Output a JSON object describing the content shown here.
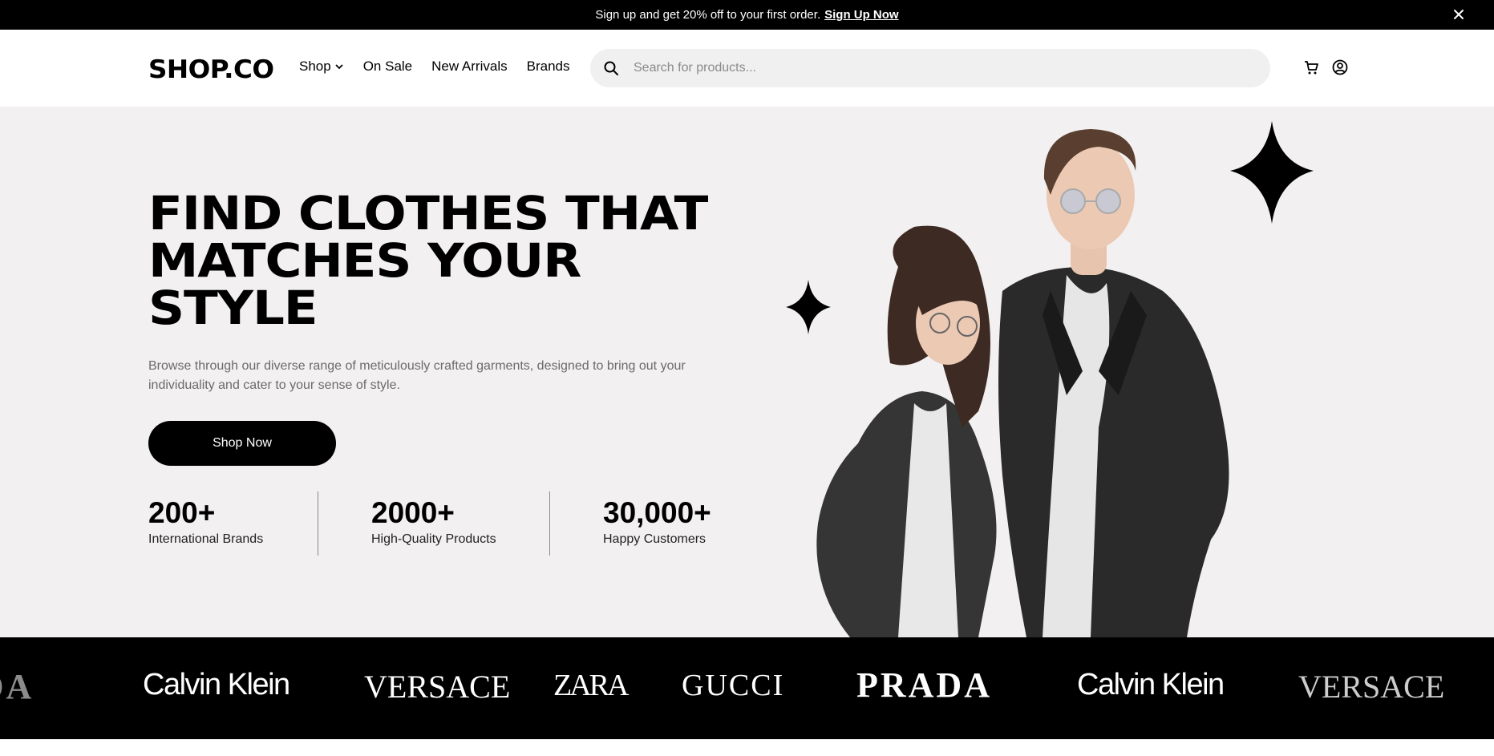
{
  "announcement": {
    "text": "Sign up and get 20% off to your first order.",
    "cta": "Sign Up Now",
    "close_icon": "close-icon"
  },
  "header": {
    "logo": "SHOP.CO",
    "nav": [
      {
        "label": "Shop",
        "has_dropdown": true
      },
      {
        "label": "On Sale"
      },
      {
        "label": "New Arrivals"
      },
      {
        "label": "Brands"
      }
    ],
    "search": {
      "placeholder": "Search for products...",
      "value": "",
      "icon": "search-icon"
    },
    "icons": [
      "cart-icon",
      "account-icon"
    ]
  },
  "hero": {
    "headline_lines": [
      "FIND CLOTHES THAT",
      "MATCHES YOUR",
      "STYLE"
    ],
    "subtitle": "Browse through our diverse range of meticulously crafted garments, designed to bring out your individuality and cater to your sense of style.",
    "button": "Shop Now",
    "stats": [
      {
        "value": "200+",
        "label": "International Brands"
      },
      {
        "value": "2000+",
        "label": "High-Quality Products"
      },
      {
        "value": "30,000+",
        "label": "Happy Customers"
      }
    ]
  },
  "brands": [
    "ADA",
    "Calvin Klein",
    "VERSACE",
    "ZARA",
    "GUCCI",
    "PRADA",
    "Calvin Klein",
    "VERSACE"
  ],
  "colors": {
    "black": "#000000",
    "hero_bg": "#f2f0f1",
    "muted_text": "#6b6b6b",
    "search_bg": "#f0f0f0"
  }
}
